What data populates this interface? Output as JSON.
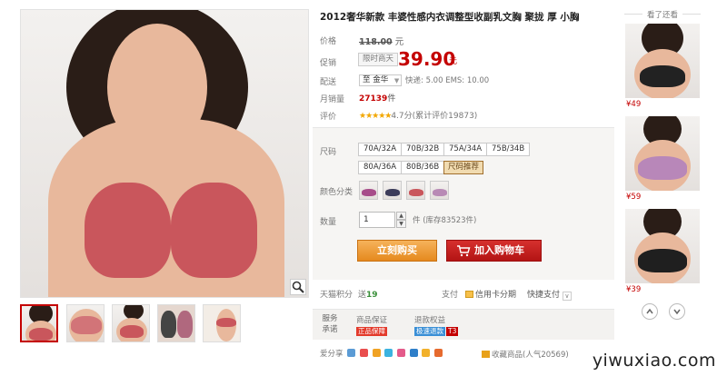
{
  "product": {
    "title": "2012奢华新款 丰婆性感内衣调整型收副乳文胸 聚拢 厚 小胸"
  },
  "labels": {
    "price": "价格",
    "promo": "促销",
    "shipping": "配送",
    "monthly_sales": "月销量",
    "rating": "评价",
    "size": "尺码",
    "color": "颜色分类",
    "quantity": "数量",
    "points": "天猫积分",
    "payment": "支付"
  },
  "pricing": {
    "original": "118.00",
    "original_unit": "元",
    "promo_tag": "限时商天",
    "promo_price": "39.90",
    "promo_unit": "元"
  },
  "shipping": {
    "destination": "至 金华",
    "info": "快递: 5.00 EMS: 10.00"
  },
  "sales": {
    "count": "27139",
    "unit": "件"
  },
  "rating": {
    "stars": "★★★★★",
    "text": "4.7分(累计评价19873)"
  },
  "sizes": [
    "70A/32A",
    "70B/32B",
    "75A/34A",
    "75B/34B",
    "80A/36A",
    "80B/36B"
  ],
  "size_tip": "尺码推荐",
  "quantity": {
    "value": "1",
    "stock": "件 (库存83523件)",
    "up": "▲",
    "down": "▼"
  },
  "actions": {
    "buy_now": "立刻购买",
    "add_to_cart": "加入购物车"
  },
  "points": {
    "send_label": "送",
    "value": "19",
    "credit": "信用卡分期",
    "quick_pay": "快捷支付"
  },
  "service": {
    "header": "服务承诺",
    "guarantee_label": "商品保证",
    "guarantee_badge": "正品保障",
    "refund_label": "退款权益",
    "refund_badge": "极速退款",
    "refund_extra": "T3"
  },
  "share": {
    "label": "爱分享",
    "favorite": "收藏商品(人气20569)"
  },
  "side": {
    "header": "看了还看",
    "prices": [
      "¥49",
      "¥59",
      "¥39"
    ]
  },
  "watermark": "yiwuxiao.com",
  "colors": {
    "brand_red": "#c40000",
    "buy_orange": "#e5891e",
    "cart_red": "#b31414",
    "star": "#f2a700"
  },
  "icons": {
    "zoom": "magnifier-icon",
    "cart": "cart-icon",
    "nav_up": "chevron-up-icon",
    "nav_down": "chevron-down-icon"
  }
}
